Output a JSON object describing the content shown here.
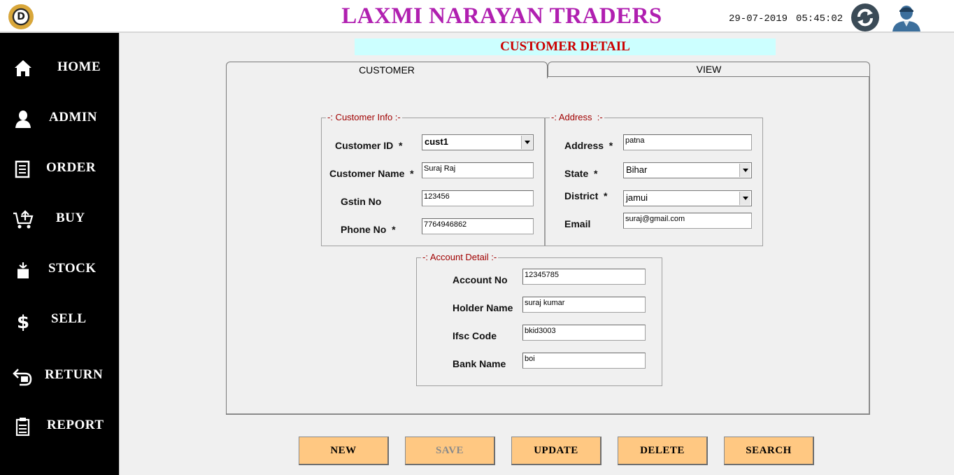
{
  "header": {
    "logo_letter": "D",
    "title": "LAXMI NARAYAN TRADERS",
    "date": "29-07-2019",
    "time": "05:45:02"
  },
  "icons": {
    "logo": "logo-icon",
    "refresh": "refresh-icon",
    "user": "user-icon"
  },
  "sidebar": {
    "items": [
      {
        "label": "HOME",
        "icon": "home-icon"
      },
      {
        "label": "ADMIN",
        "icon": "person-icon"
      },
      {
        "label": "ORDER",
        "icon": "document-icon"
      },
      {
        "label": "BUY",
        "icon": "cart-icon"
      },
      {
        "label": "STOCK",
        "icon": "box-icon"
      },
      {
        "label": "SELL",
        "icon": "dollar-icon"
      },
      {
        "label": "RETURN",
        "icon": "return-icon"
      },
      {
        "label": "REPORT",
        "icon": "clipboard-icon"
      }
    ]
  },
  "page": {
    "title": "CUSTOMER DETAIL"
  },
  "tabs": [
    {
      "label": "CUSTOMER",
      "active": true
    },
    {
      "label": "VIEW",
      "active": false
    }
  ],
  "customer_info": {
    "legend": "-: Customer Info :-",
    "customer_id_label": "Customer ID  *",
    "customer_id": "cust1",
    "customer_name_label": "Customer Name  *",
    "customer_name": "Suraj Raj",
    "gstin_label": "Gstin No",
    "gstin": "123456",
    "phone_label": "Phone No  *",
    "phone": "7764946862"
  },
  "address": {
    "legend": "-: Address  :-",
    "address_label": "Address  *",
    "address": "patna",
    "state_label": "State  *",
    "state": "Bihar",
    "district_label": "District  *",
    "district": "jamui",
    "email_label": "Email",
    "email": "suraj@gmail.com"
  },
  "account": {
    "legend": "-: Account Detail :-",
    "account_no_label": "Account No",
    "account_no": "12345785",
    "holder_label": "Holder Name",
    "holder": "suraj kumar",
    "ifsc_label": "Ifsc Code",
    "ifsc": "bkid3003",
    "bank_label": "Bank Name",
    "bank": "boi"
  },
  "buttons": {
    "new": "NEW",
    "save": "SAVE",
    "update": "UPDATE",
    "delete": "DELETE",
    "search": "SEARCH"
  },
  "colors": {
    "title": "#b01fb0",
    "page_title": "#cc0000",
    "page_title_bg": "#ccffff",
    "button_bg": "#ffc882",
    "sidebar_bg": "#000000"
  }
}
